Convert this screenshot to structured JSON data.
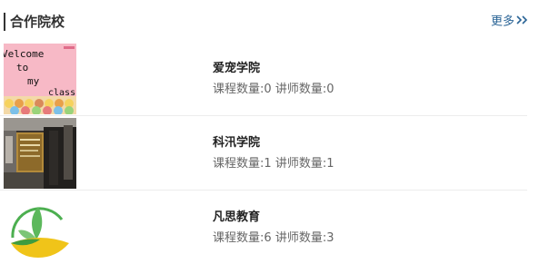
{
  "header": {
    "title": "合作院校",
    "more_label": "更多"
  },
  "colors": {
    "link": "#2a6496",
    "divider": "#ececec",
    "title_bar": "#333333"
  },
  "schools": [
    {
      "name": "爱宠学院",
      "course_label": "课程数量:",
      "course_count": "0",
      "teacher_label": "讲师数量:",
      "teacher_count": "0",
      "thumb": {
        "icon": "welcome-chalkboard-image",
        "lines": [
          "Velcome",
          "to",
          "my",
          "class"
        ]
      }
    },
    {
      "name": "科汛学院",
      "course_label": "课程数量:",
      "course_count": "1",
      "teacher_label": "讲师数量:",
      "teacher_count": "1",
      "thumb": {
        "icon": "building-entrance-photo"
      }
    },
    {
      "name": "凡思教育",
      "course_label": "课程数量:",
      "course_count": "6",
      "teacher_label": "讲师数量:",
      "teacher_count": "3",
      "thumb": {
        "icon": "leaf-logo"
      }
    }
  ]
}
